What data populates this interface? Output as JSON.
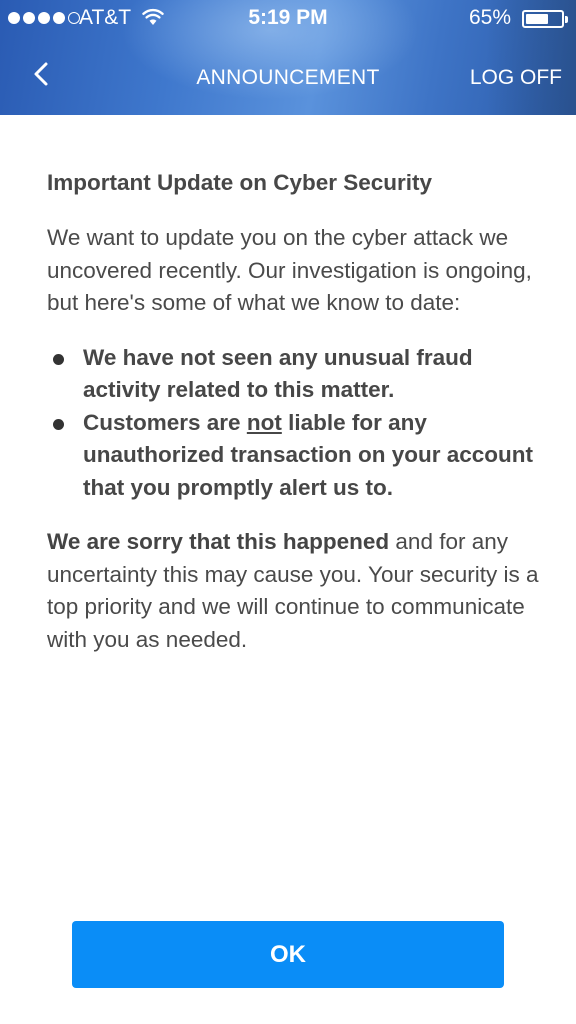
{
  "status_bar": {
    "carrier": "AT&T",
    "time": "5:19 PM",
    "battery_percent": "65%",
    "battery_level": 0.65
  },
  "nav": {
    "back_icon": "chevron-left-icon",
    "title": "ANNOUNCEMENT",
    "logoff_label": "LOG OFF"
  },
  "announcement": {
    "heading": "Important Update on Cyber Security",
    "intro": "We want to update you on the cyber attack we uncovered recently. Our investigation is ongoing, but here's some of what we know to date:",
    "bullet1": "We have not seen any unusual fraud activity related to this matter.",
    "bullet2_pre": "Customers are ",
    "bullet2_not": "not",
    "bullet2_post": " liable for any unauthorized transaction on your account that you promptly alert us to.",
    "closing_bold": "We are sorry that this happened",
    "closing_rest": " and for any uncertainty this may cause you. Your security is a top priority and we will continue to communicate with you as needed."
  },
  "actions": {
    "ok_label": "OK"
  },
  "colors": {
    "header_blue": "#3f78cd",
    "button_blue": "#0a8df7",
    "text_gray": "#4a4a4a"
  }
}
